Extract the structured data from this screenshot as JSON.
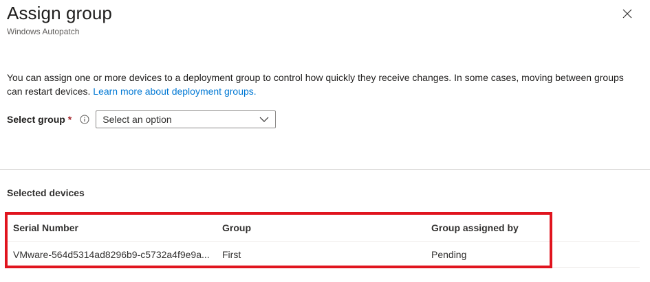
{
  "panel": {
    "title": "Assign group",
    "subtitle": "Windows Autopatch",
    "close_icon": "close-icon"
  },
  "description": {
    "text": "You can assign one or more devices to a deployment group to control how quickly they receive changes. In some cases, moving between groups can restart devices. ",
    "link_text": "Learn more about deployment groups."
  },
  "select_group": {
    "label": "Select group",
    "required_marker": "*",
    "info_icon": "info-icon",
    "placeholder": "Select an option",
    "chevron_icon": "chevron-down-icon"
  },
  "selected_devices": {
    "title": "Selected devices",
    "columns": [
      "Serial Number",
      "Group",
      "Group assigned by"
    ],
    "rows": [
      {
        "serial": "VMware-564d5314ad8296b9-c5732a4f9e9a...",
        "group": "First",
        "assigned_by": "Pending"
      }
    ]
  },
  "colors": {
    "link": "#0078d4",
    "highlight_border": "#e0141e",
    "required": "#a4262c"
  }
}
